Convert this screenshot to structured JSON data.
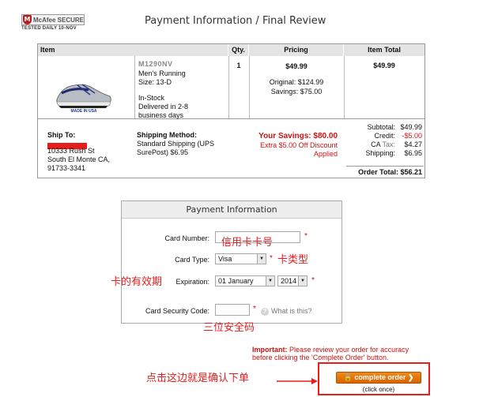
{
  "badge": {
    "name": "McAfee SECURE",
    "subtitle": "TESTED DAILY   10-NOV"
  },
  "page_title": "Payment Information / Final Review",
  "order_table": {
    "headers": {
      "item": "Item",
      "qty": "Qty.",
      "pricing": "Pricing",
      "item_total": "Item Total"
    },
    "item": {
      "sku": "M1290NV",
      "name": "Men's Running",
      "size": "Size: 13-D",
      "stock": "In-Stock",
      "delivery_1": "Delivered in 2-8",
      "delivery_2": "business days",
      "image_caption": "MADE IN USA",
      "qty": "1",
      "price": "$49.99",
      "original": "Original: $124.99",
      "savings": "Savings: $75.00",
      "item_total": "$49.99"
    },
    "ship_to": {
      "label": "Ship To:",
      "line1": "10333 Rush St",
      "line2": "South El Monte CA,",
      "line3": "91733-3341"
    },
    "shipping_method": {
      "label": "Shipping Method:",
      "line1": "Standard Shipping (UPS",
      "line2": "SurePost) $6.95"
    },
    "your_savings": {
      "title": "Your Savings: $80.00",
      "line1": "Extra $5.00 Off Discount",
      "line2": "Applied"
    },
    "totals": {
      "subtotal_label": "Subtotal:",
      "subtotal": "$49.99",
      "credit_label": "Credit:",
      "credit": "-$5.00",
      "tax_prefix": "CA",
      "tax_label": "Tax:",
      "tax": "$4.27",
      "shipping_label": "Shipping:",
      "shipping": "$6.95",
      "order_total_label": "Order Total:",
      "order_total": "$56.21"
    }
  },
  "payment": {
    "title": "Payment Information",
    "card_number_label": "Card Number:",
    "card_type_label": "Card Type:",
    "card_type_value": "Visa",
    "expiration_label": "Expiration:",
    "exp_month": "01 January",
    "exp_year": "2014",
    "csc_label": "Card Security Code:",
    "what_is_this": "What is this?",
    "required_mark": "*"
  },
  "annotations": {
    "card_number": "信用卡卡号",
    "card_type": "卡类型",
    "expiration": "卡的有效期",
    "csc": "三位安全码",
    "complete": "点击这边就是确认下单"
  },
  "footer": {
    "important_label": "Important:",
    "important_text": "Please review your order for accuracy before clicking the 'Complete Order' button.",
    "complete_button": "complete order",
    "click_once": "(click once)"
  },
  "colors": {
    "accent_red": "#cc1111",
    "annotation_red": "#e51d1d",
    "button_orange": "#e67a0e"
  }
}
